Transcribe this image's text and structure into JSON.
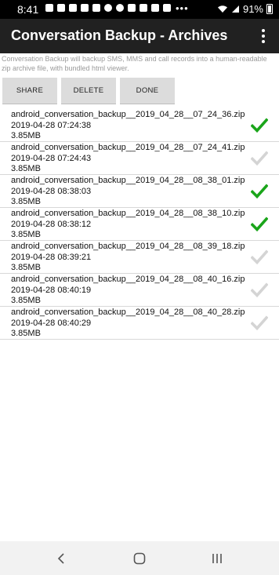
{
  "status_bar": {
    "time": "8:41",
    "notification_icons": [
      "f-icon",
      "f-icon",
      "youtube-icon",
      "youtube-icon",
      "linkedin-icon",
      "wave-icon",
      "chrome-icon",
      "s-icon",
      "tool-icon",
      "bookmark-icon",
      "arrows-icon"
    ],
    "more_dots": "•••",
    "battery_text": "91%",
    "right_icons": [
      "wifi-icon",
      "signal-icon",
      "battery-icon"
    ]
  },
  "app_bar": {
    "title": "Conversation Backup - Archives",
    "overflow_icon": "more-vert-icon"
  },
  "description": "Conversation Backup will backup SMS, MMS and call records into a human-readable zip archive file, with bundled html viewer.",
  "buttons": {
    "share": "SHARE",
    "delete": "DELETE",
    "done": "DONE"
  },
  "files": [
    {
      "name": "android_conversation_backup__2019_04_28__07_24_36.zip",
      "date": "2019-04-28 07:24:38",
      "size": "3.85MB",
      "checked": true
    },
    {
      "name": "android_conversation_backup__2019_04_28__07_24_41.zip",
      "date": "2019-04-28 07:24:43",
      "size": "3.85MB",
      "checked": false
    },
    {
      "name": "android_conversation_backup__2019_04_28__08_38_01.zip",
      "date": "2019-04-28 08:38:03",
      "size": "3.85MB",
      "checked": true
    },
    {
      "name": "android_conversation_backup__2019_04_28__08_38_10.zip",
      "date": "2019-04-28 08:38:12",
      "size": "3.85MB",
      "checked": true
    },
    {
      "name": "android_conversation_backup__2019_04_28__08_39_18.zip",
      "date": "2019-04-28 08:39:21",
      "size": "3.85MB",
      "checked": false
    },
    {
      "name": "android_conversation_backup__2019_04_28__08_40_16.zip",
      "date": "2019-04-28 08:40:19",
      "size": "3.85MB",
      "checked": false
    },
    {
      "name": "android_conversation_backup__2019_04_28__08_40_28.zip",
      "date": "2019-04-28 08:40:29",
      "size": "3.85MB",
      "checked": false
    }
  ],
  "colors": {
    "checked": "#1aa51a",
    "unchecked": "#d4d4d4",
    "app_bar": "#212121"
  },
  "nav_bar": {
    "icons": [
      "back-icon",
      "home-icon",
      "recents-icon"
    ]
  }
}
